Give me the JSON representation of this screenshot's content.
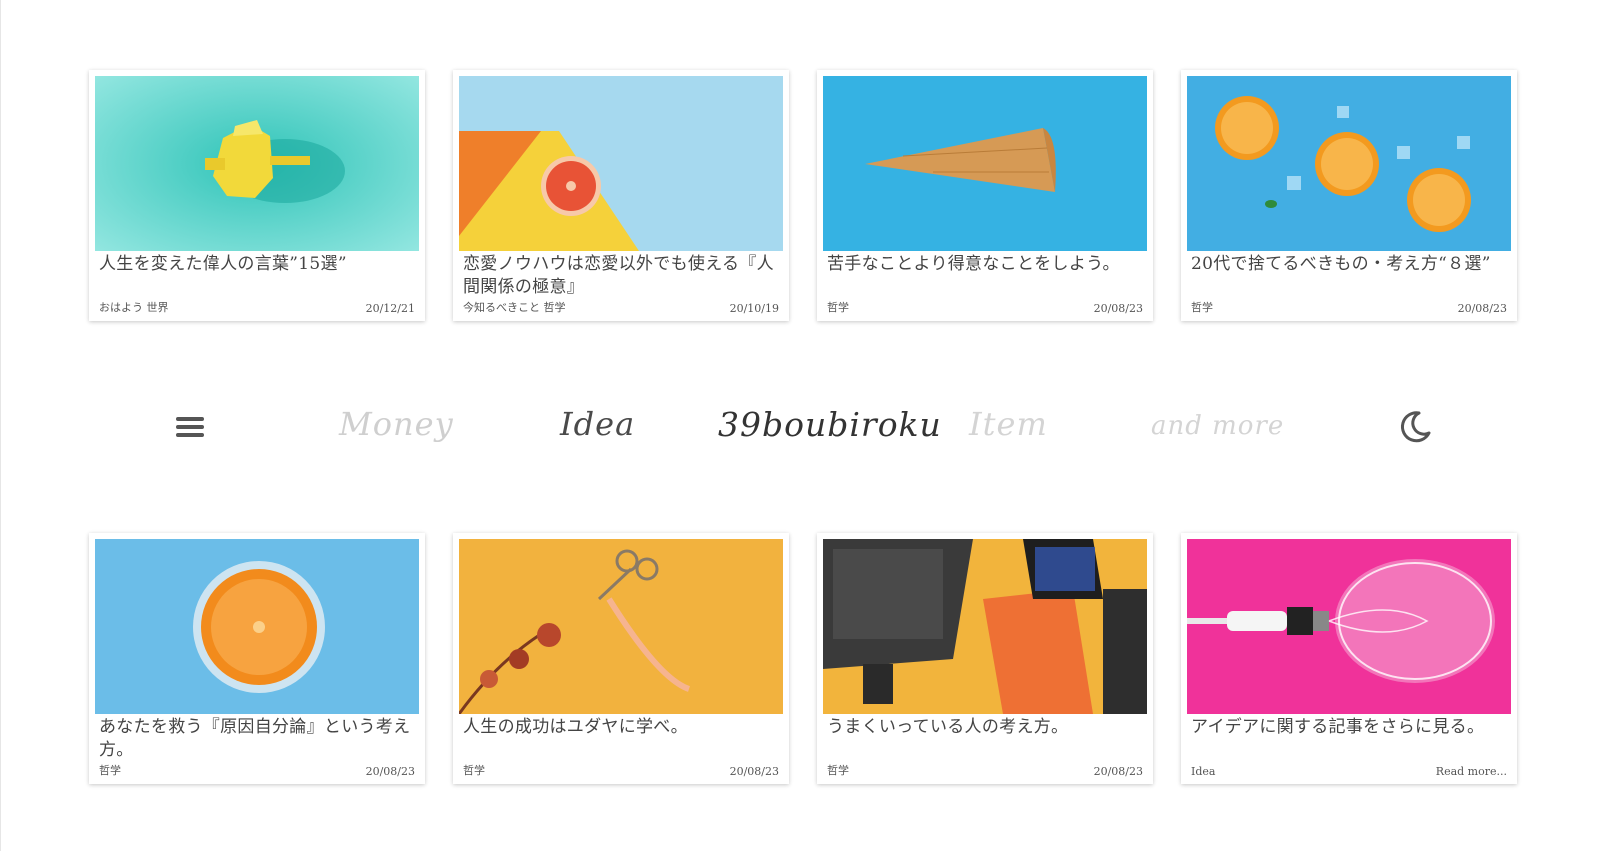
{
  "top_cards": [
    {
      "title": "人生を変えた偉人の言葉”15選”",
      "category": "おはよう 世界",
      "date": "20/12/21",
      "image": "yellow-coffee-pot-on-teal"
    },
    {
      "title": "恋愛ノウハウは恋愛以外でも使える『人間関係の極意』",
      "category": "今知るべきこと 哲学",
      "date": "20/10/19",
      "image": "grapefruit-half-on-blue-yellow"
    },
    {
      "title": "苦手なことより得意なことをしよう。",
      "category": "哲学",
      "date": "20/08/23",
      "image": "waffle-cone-on-blue"
    },
    {
      "title": "20代で捨てるべきもの・考え方“８選”",
      "category": "哲学",
      "date": "20/08/23",
      "image": "orange-slices-with-ice-on-blue"
    }
  ],
  "nav": {
    "menu_icon": "hamburger-icon",
    "links": [
      "Money",
      "Idea",
      "Item",
      "and more"
    ],
    "logo": "39boubiroku",
    "theme_icon": "moon-icon"
  },
  "bottom_cards": [
    {
      "title": "あなたを救う『原因自分論』という考え方。",
      "category": "哲学",
      "date": "20/08/23",
      "image": "orange-in-glass-on-blue"
    },
    {
      "title": "人生の成功はユダヤに学べ。",
      "category": "哲学",
      "date": "20/08/23",
      "image": "dried-flowers-scissors-on-yellow"
    },
    {
      "title": "うまくいっている人の考え方。",
      "category": "哲学",
      "date": "20/08/23",
      "image": "change-by-design-book-desk"
    },
    {
      "title": "アイデアに関する記事をさらに見る。",
      "category": "Idea",
      "date": "Read more...",
      "image": "lightbulb-on-pink"
    }
  ],
  "colors": {
    "card_shadow": "#cccccc",
    "text": "#444444",
    "nav_active": "#4a4a4a",
    "nav_inactive": "#d4d4d4"
  }
}
